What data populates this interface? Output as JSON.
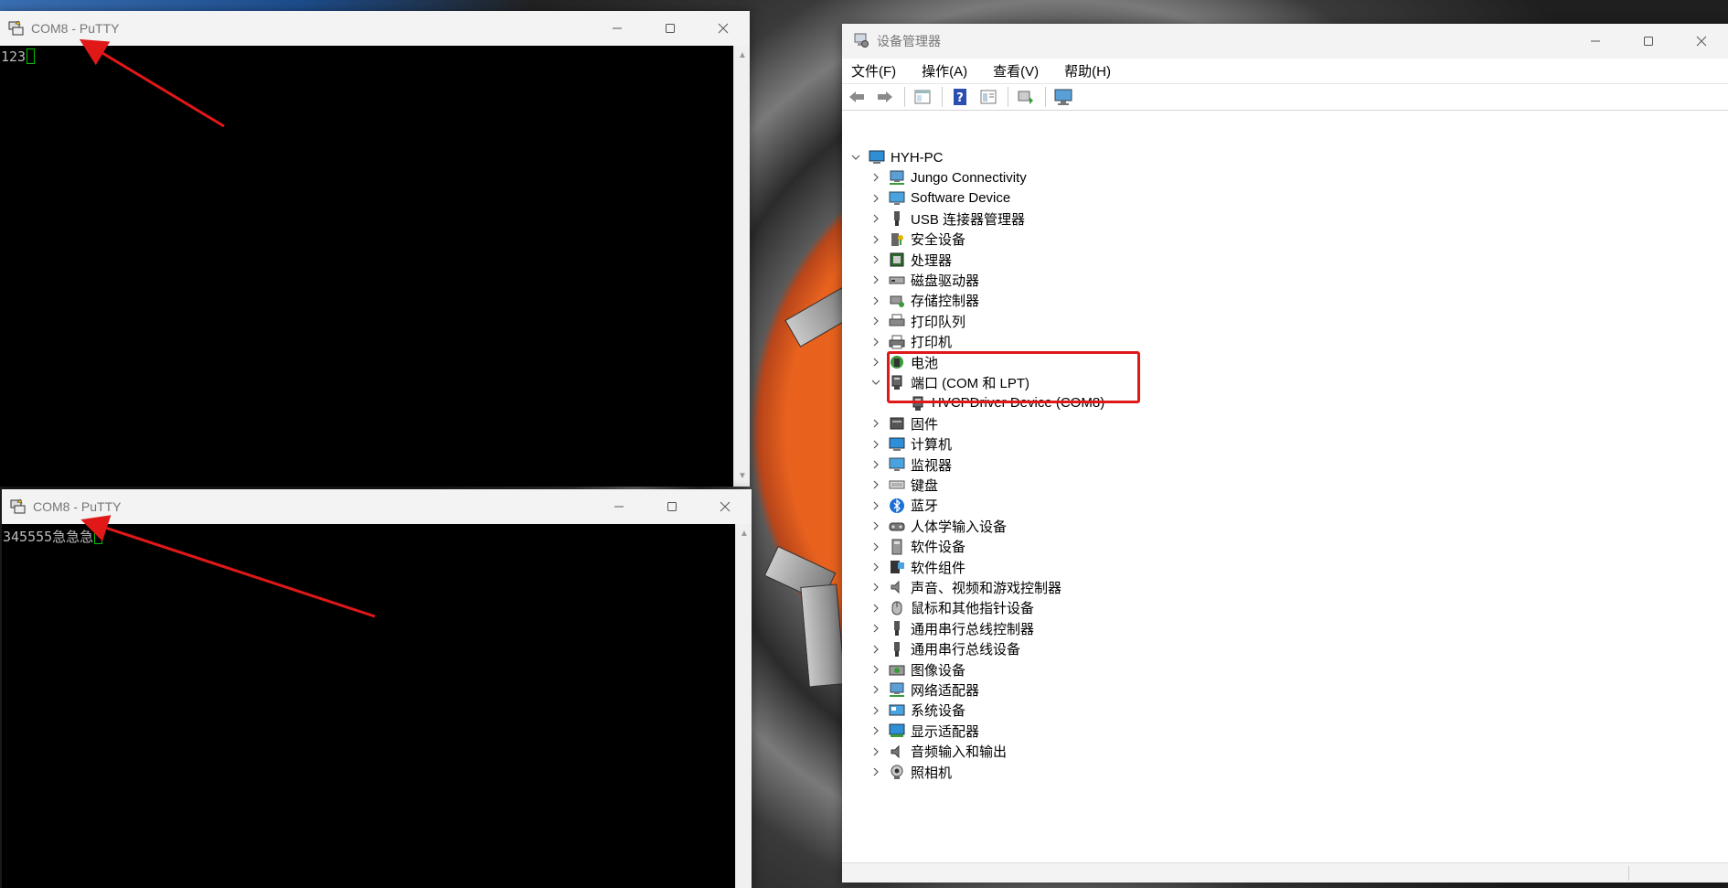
{
  "putty_top": {
    "title": "COM8 - PuTTY",
    "terminal_text": "123"
  },
  "putty_bottom": {
    "title": "COM8 - PuTTY",
    "terminal_text": "345555急急急"
  },
  "devmgr": {
    "title": "设备管理器",
    "menu": [
      "文件(F)",
      "操作(A)",
      "查看(V)",
      "帮助(H)"
    ],
    "toolbar_icons": [
      "back-arrow-icon",
      "forward-arrow-icon",
      "properties-icon",
      "help-icon",
      "view-icon",
      "update-driver-icon",
      "scan-hardware-icon"
    ],
    "root": "HYH-PC",
    "categories": [
      {
        "label": "Jungo Connectivity",
        "icon": "network-icon"
      },
      {
        "label": "Software Device",
        "icon": "monitor-icon"
      },
      {
        "label": "USB 连接器管理器",
        "icon": "usb-icon"
      },
      {
        "label": "安全设备",
        "icon": "security-key-icon"
      },
      {
        "label": "处理器",
        "icon": "cpu-icon"
      },
      {
        "label": "磁盘驱动器",
        "icon": "disk-icon"
      },
      {
        "label": "存储控制器",
        "icon": "storage-icon"
      },
      {
        "label": "打印队列",
        "icon": "print-queue-icon"
      },
      {
        "label": "打印机",
        "icon": "printer-icon"
      },
      {
        "label": "电池",
        "icon": "battery-icon"
      },
      {
        "label": "端口 (COM 和 LPT)",
        "icon": "port-icon",
        "expanded": true
      },
      {
        "label": "固件",
        "icon": "firmware-icon"
      },
      {
        "label": "计算机",
        "icon": "computer-icon"
      },
      {
        "label": "监视器",
        "icon": "monitor-icon"
      },
      {
        "label": "键盘",
        "icon": "keyboard-icon"
      },
      {
        "label": "蓝牙",
        "icon": "bluetooth-icon"
      },
      {
        "label": "人体学输入设备",
        "icon": "hid-icon"
      },
      {
        "label": "软件设备",
        "icon": "software-device-icon"
      },
      {
        "label": "软件组件",
        "icon": "software-component-icon"
      },
      {
        "label": "声音、视频和游戏控制器",
        "icon": "speaker-icon"
      },
      {
        "label": "鼠标和其他指针设备",
        "icon": "mouse-icon"
      },
      {
        "label": "通用串行总线控制器",
        "icon": "usb-icon"
      },
      {
        "label": "通用串行总线设备",
        "icon": "usb-icon"
      },
      {
        "label": "图像设备",
        "icon": "camera-icon"
      },
      {
        "label": "网络适配器",
        "icon": "network-icon"
      },
      {
        "label": "系统设备",
        "icon": "system-icon"
      },
      {
        "label": "显示适配器",
        "icon": "display-adapter-icon"
      },
      {
        "label": "音频输入和输出",
        "icon": "audio-icon"
      },
      {
        "label": "照相机",
        "icon": "webcam-icon"
      }
    ],
    "port_child": {
      "label": "HVCPDriver Device (COM8)",
      "icon": "port-icon"
    }
  },
  "colors": {
    "annotation_red": "#e01818",
    "terminal_bg": "#000000",
    "cursor_green": "#00c000"
  }
}
